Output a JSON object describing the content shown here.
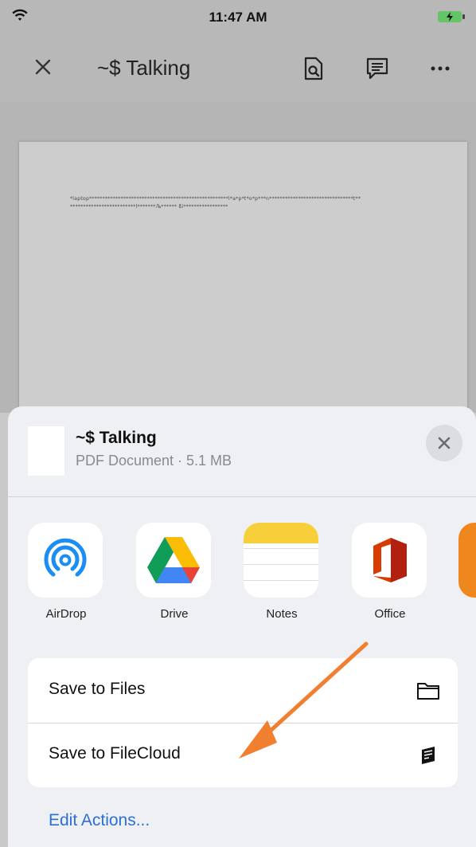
{
  "status": {
    "time": "11:47 AM"
  },
  "nav": {
    "title": "~$ Talking"
  },
  "document": {
    "line1": "*laptop*****************************************************l*a*p*t*o*p***n********************************t**",
    "line2": "*************************l*******Љ****** ßi*****************"
  },
  "share": {
    "title": "~$ Talking",
    "subtitle": "PDF Document · 5.1 MB",
    "apps": [
      {
        "label": "AirDrop",
        "icon": "airdrop-icon"
      },
      {
        "label": "Drive",
        "icon": "google-drive-icon"
      },
      {
        "label": "Notes",
        "icon": "notes-icon"
      },
      {
        "label": "Office",
        "icon": "office-icon"
      }
    ],
    "actions": [
      {
        "label": "Save to Files",
        "icon": "folder-icon"
      },
      {
        "label": "Save to FileCloud",
        "icon": "filecloud-icon"
      }
    ],
    "edit_actions": "Edit Actions..."
  },
  "colors": {
    "accent": "#2c6fd6",
    "annotation_arrow": "#f07f2f"
  }
}
